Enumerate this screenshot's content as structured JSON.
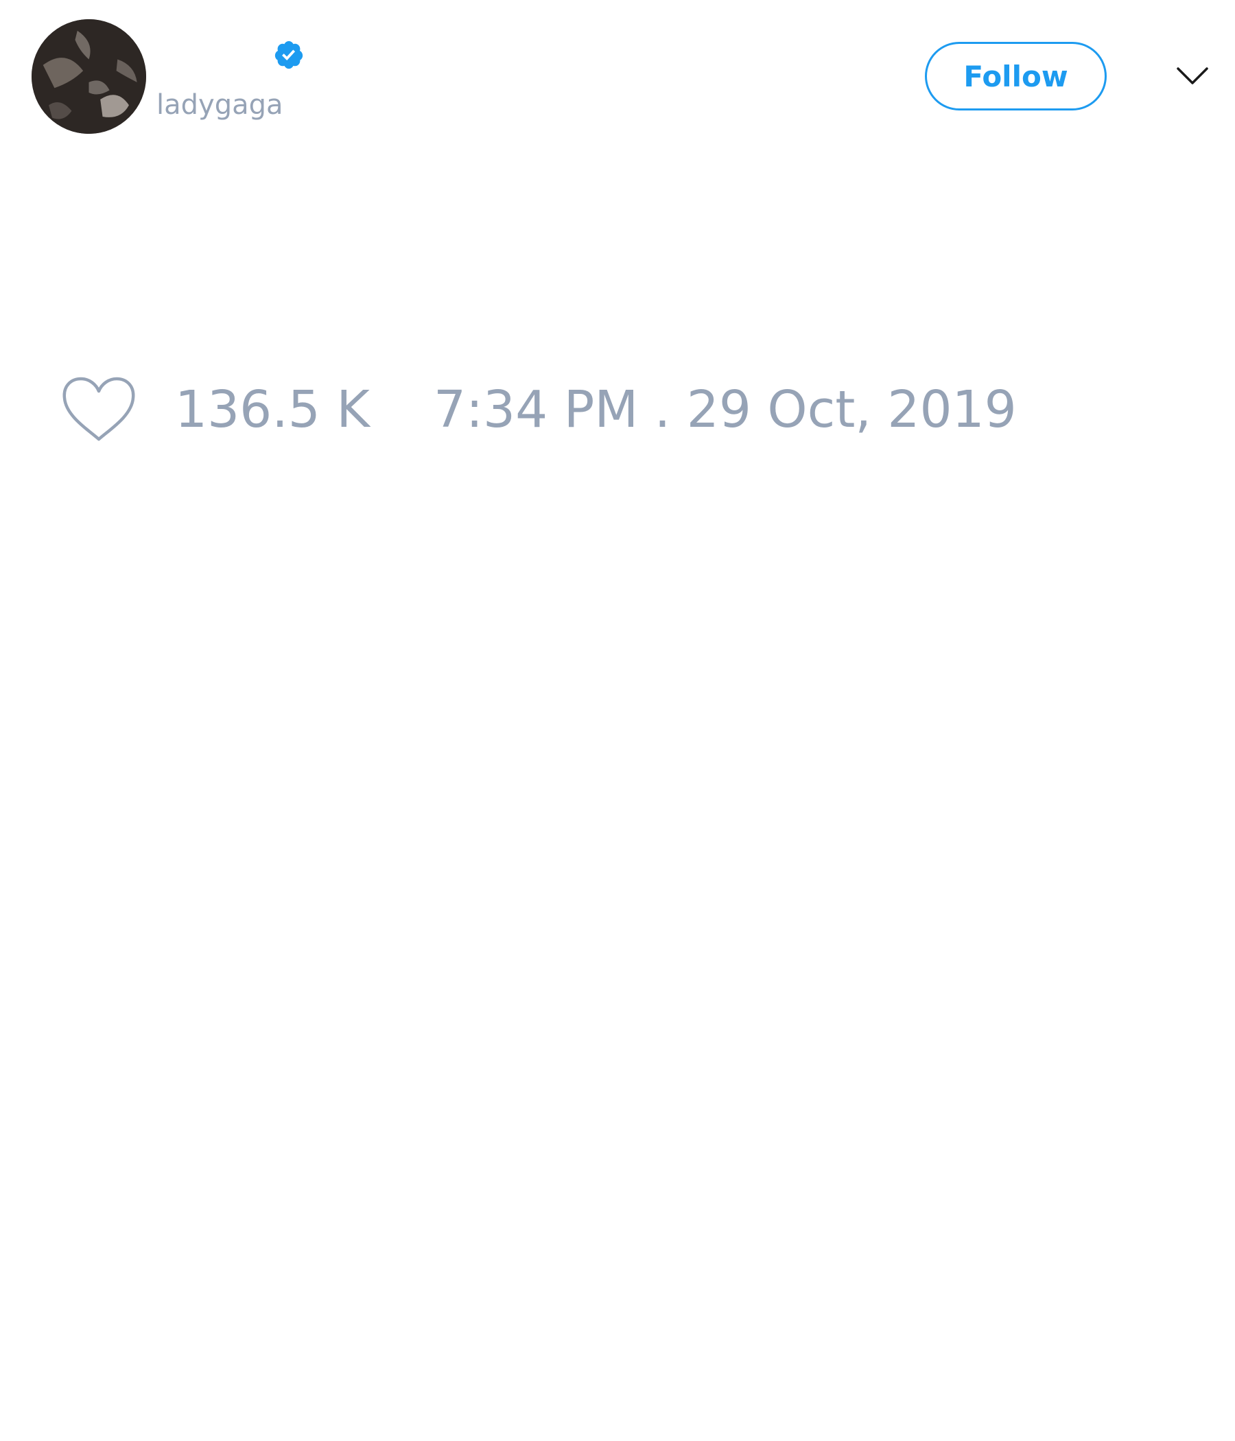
{
  "tweet": {
    "author": {
      "handle": "ladygaga",
      "verified": true,
      "avatar_icon": "profile-photo"
    },
    "follow_label": "Follow",
    "menu_icon": "chevron-down-icon",
    "like_icon": "heart-outline-icon",
    "like_count": "136.5 K",
    "timestamp": "7:34 PM . 29 Oct, 2019"
  },
  "colors": {
    "accent": "#1d9bf0",
    "muted_text": "#96a3b6",
    "background": "#ffffff"
  }
}
